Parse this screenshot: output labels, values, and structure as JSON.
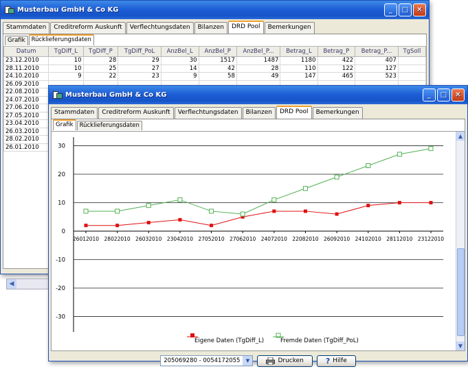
{
  "window_title": "Musterbau GmbH & Co KG",
  "title_buttons": {
    "minimize": "_",
    "maximize": "□",
    "close": "✕"
  },
  "tabs": [
    "Stammdaten",
    "Creditreform Auskunft",
    "Verflechtungsdaten",
    "Bilanzen",
    "DRD Pool",
    "Bemerkungen"
  ],
  "subtabs": [
    "Grafik",
    "Rücklieferungsdaten"
  ],
  "back_window": {
    "columns": [
      "Datum",
      "TgDiff_L",
      "TgDiff_P",
      "TgDiff_PoL",
      "AnzBel_L",
      "AnzBel_P",
      "AnzBel_P...",
      "Betrag_L",
      "Betrag_P",
      "Betrag_P...",
      "TgSoll"
    ],
    "rows": [
      [
        "23.12.2010",
        "10",
        "28",
        "29",
        "30",
        "1517",
        "1487",
        "1180",
        "422",
        "407",
        ""
      ],
      [
        "28.11.2010",
        "10",
        "25",
        "27",
        "14",
        "42",
        "28",
        "110",
        "122",
        "127",
        ""
      ],
      [
        "24.10.2010",
        "9",
        "22",
        "23",
        "9",
        "58",
        "49",
        "147",
        "465",
        "523",
        ""
      ],
      [
        "26.09.2010",
        "",
        "",
        "",
        "",
        "",
        "",
        "",
        "",
        "",
        ""
      ],
      [
        "22.08.2010",
        "",
        "",
        "",
        "",
        "",
        "",
        "",
        "",
        "",
        ""
      ],
      [
        "24.07.2010",
        "",
        "",
        "",
        "",
        "",
        "",
        "",
        "",
        "",
        ""
      ],
      [
        "27.06.2010",
        "",
        "",
        "",
        "",
        "",
        "",
        "",
        "",
        "",
        ""
      ],
      [
        "27.05.2010",
        "",
        "",
        "",
        "",
        "",
        "",
        "",
        "",
        "",
        ""
      ],
      [
        "23.04.2010",
        "",
        "",
        "",
        "",
        "",
        "",
        "",
        "",
        "",
        ""
      ],
      [
        "26.03.2010",
        "",
        "",
        "",
        "",
        "",
        "",
        "",
        "",
        "",
        ""
      ],
      [
        "28.02.2010",
        "",
        "",
        "",
        "",
        "",
        "",
        "",
        "",
        "",
        ""
      ],
      [
        "26.01.2010",
        "",
        "",
        "",
        "",
        "",
        "",
        "",
        "",
        "",
        ""
      ]
    ]
  },
  "bottom": {
    "combo_value": "205069280 - 0054172055",
    "print_label": "Drucken",
    "help_label": "Hilfe"
  },
  "chart_data": {
    "type": "line",
    "x": [
      "26012010",
      "28022010",
      "26032010",
      "23042010",
      "27052010",
      "27062010",
      "24072010",
      "22082010",
      "26092010",
      "24102010",
      "28112010",
      "23122010"
    ],
    "yticks": [
      30,
      20,
      10,
      0,
      -10,
      -20,
      -30
    ],
    "ylim": [
      -33,
      33
    ],
    "grid": true,
    "legend_position": "bottom",
    "series": [
      {
        "name": "Eigene Daten (TgDiff_L)",
        "color": "#e01010",
        "values": [
          2,
          2,
          3,
          4,
          2,
          5,
          7,
          7,
          6,
          9,
          10,
          10
        ]
      },
      {
        "name": "Fremde Daten (TgDiff_PoL)",
        "color": "#50b050",
        "values": [
          7,
          7,
          9,
          11,
          7,
          6,
          11,
          15,
          19,
          23,
          27,
          29
        ]
      }
    ]
  }
}
